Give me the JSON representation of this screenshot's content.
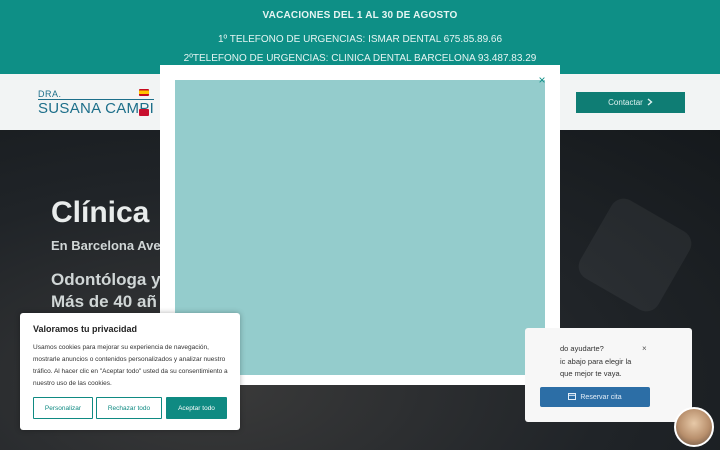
{
  "topbar": {
    "line1": "VACACIONES DEL 1 AL 30 DE AGOSTO",
    "line2": "1º TELEFONO DE URGENCIAS: ISMAR DENTAL 675.85.89.66",
    "line3": "2ºTELEFONO DE URGENCIAS: CLINICA DENTAL BARCELONA 93.487.83.29"
  },
  "header": {
    "logo_small": "DRA.",
    "logo_big": "SUSANA CAMPI",
    "contact_label": "Contactar",
    "contact_icon": "chevron-right-icon"
  },
  "hero": {
    "title": "Clínica",
    "subtitle": "En Barcelona Ave",
    "tagline_1": "Odontóloga y",
    "tagline_2": "Más de 40 añ"
  },
  "modal": {
    "close_glyph": "×"
  },
  "cookie": {
    "title": "Valoramos tu privacidad",
    "text": "Usamos cookies para mejorar su experiencia de navegación, mostrarle anuncios o contenidos personalizados y analizar nuestro tráfico. Al hacer clic en \"Aceptar todo\" usted da su consentimiento a nuestro uso de las cookies.",
    "customize_label": "Personalizar",
    "reject_label": "Rechazar todo",
    "accept_label": "Aceptar todo"
  },
  "chat": {
    "line1": "do ayudarte?",
    "close_glyph": "×",
    "line2a": "ic abajo para elegir la",
    "line2b": "que mejor te vaya.",
    "book_label": "Reservar cita",
    "book_icon": "calendar-icon"
  },
  "colors": {
    "teal": "#0e8f86",
    "modal_inner": "#94cccc",
    "chat_button": "#2c6ea6"
  }
}
